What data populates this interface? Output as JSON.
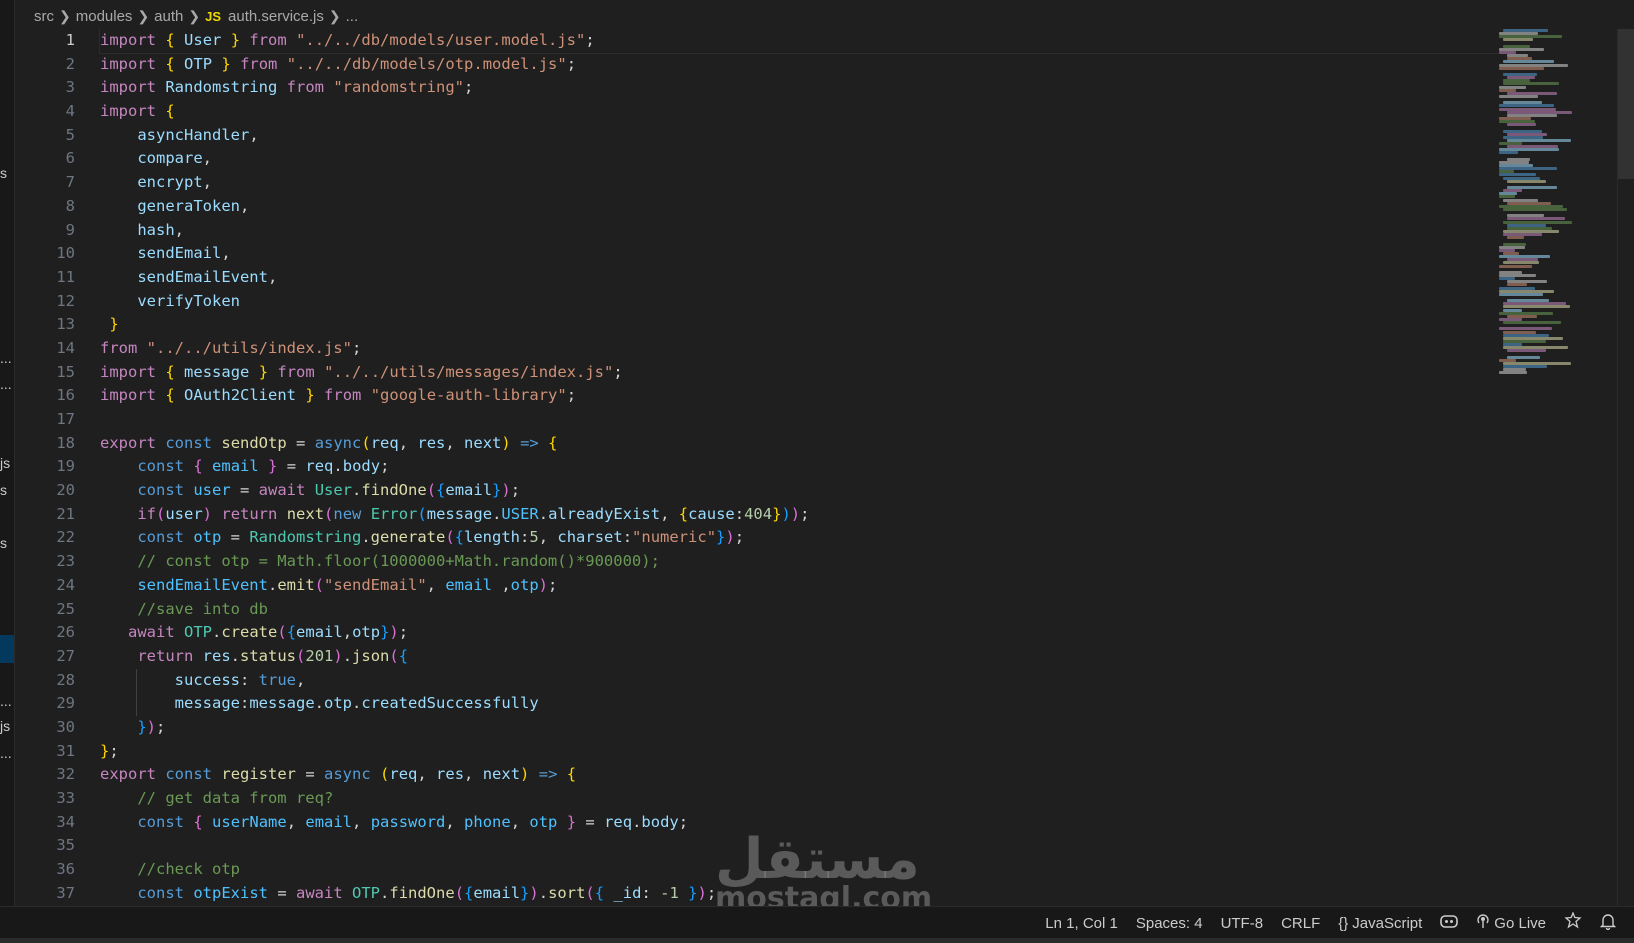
{
  "breadcrumb": {
    "items": [
      "src",
      "modules",
      "auth"
    ],
    "file_badge": "JS",
    "file": "auth.service.js",
    "tail": "..."
  },
  "sidebar_fragments": [
    "s",
    "...",
    "...",
    "js",
    "s",
    "s",
    "...",
    "js",
    "..."
  ],
  "editor": {
    "language": "JavaScript",
    "active_line": 1,
    "line_numbers": [
      1,
      2,
      3,
      4,
      5,
      6,
      7,
      8,
      9,
      10,
      11,
      12,
      13,
      14,
      15,
      16,
      17,
      18,
      19,
      20,
      21,
      22,
      23,
      24,
      25,
      26,
      27,
      28,
      29,
      30,
      31,
      32,
      33,
      34,
      35,
      36,
      37
    ]
  },
  "status": {
    "position": "Ln 1, Col 1",
    "spaces": "Spaces: 4",
    "encoding": "UTF-8",
    "eol": "CRLF",
    "language_icon": "{}",
    "language": "JavaScript",
    "go_live": "Go Live"
  },
  "watermark": {
    "arabic": "مستقل",
    "latin": "mostaql.com"
  },
  "colors": {
    "background": "#1f1f1f",
    "keyword": "#569cd6",
    "control": "#c586c0",
    "string": "#ce9178",
    "variable": "#9cdcfe",
    "function": "#dcdcaa",
    "comment": "#6a9955"
  }
}
